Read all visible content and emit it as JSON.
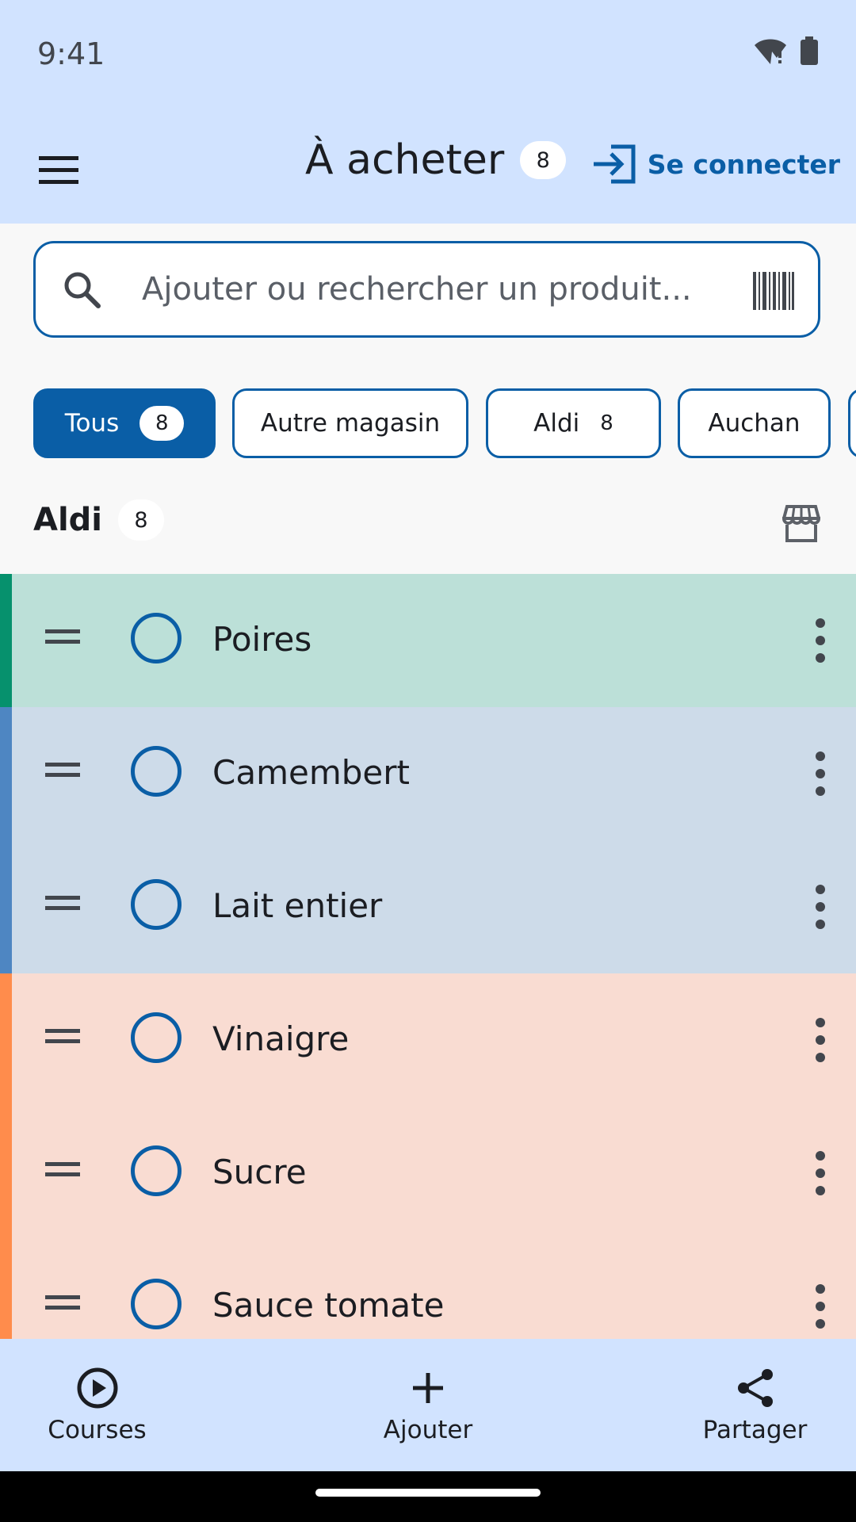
{
  "status": {
    "time": "9:41"
  },
  "appbar": {
    "title": "À acheter",
    "count": "8",
    "login_label": "Se connecter"
  },
  "search": {
    "placeholder": "Ajouter ou rechercher un produit..."
  },
  "chips": [
    {
      "label": "Tous",
      "count": "8",
      "active": true
    },
    {
      "label": "Autre magasin"
    },
    {
      "label": "Aldi",
      "count": "8"
    },
    {
      "label": "Auchan"
    }
  ],
  "section": {
    "title": "Aldi",
    "count": "8"
  },
  "items": [
    {
      "label": "Poires",
      "bg": "#bce0d8",
      "stripe": "#06916d"
    },
    {
      "label": "Camembert",
      "bg": "#cddbe9",
      "stripe": "#4e86c2"
    },
    {
      "label": "Lait entier",
      "bg": "#cddbe9",
      "stripe": "#4e86c2"
    },
    {
      "label": "Vinaigre",
      "bg": "#f9dcd2",
      "stripe": "#ff8c4c"
    },
    {
      "label": "Sucre",
      "bg": "#f9dcd2",
      "stripe": "#ff8c4c"
    },
    {
      "label": "Sauce tomate",
      "bg": "#f9dcd2",
      "stripe": "#ff8c4c"
    }
  ],
  "nav": {
    "courses": "Courses",
    "add": "Ajouter",
    "share": "Partager"
  },
  "colors": {
    "primary": "#0a5ea6",
    "appbar": "#d1e3ff"
  }
}
